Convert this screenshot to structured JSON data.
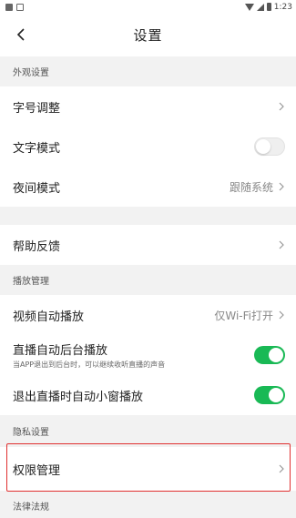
{
  "status_bar": {
    "time": "1:23"
  },
  "header": {
    "title": "设置",
    "back_icon": "chevron-left-icon"
  },
  "sections": {
    "appearance": {
      "title": "外观设置",
      "font_size": {
        "label": "字号调整"
      },
      "text_mode": {
        "label": "文字模式",
        "enabled": false
      },
      "night_mode": {
        "label": "夜间模式",
        "value": "跟随系统"
      }
    },
    "help": {
      "label": "帮助反馈"
    },
    "playback": {
      "title": "播放管理",
      "video_autoplay": {
        "label": "视频自动播放",
        "value": "仅Wi-Fi打开"
      },
      "live_background": {
        "label": "直播自动后台播放",
        "sub": "当APP退出到后台时，可以继续收听直播的声音",
        "enabled": true
      },
      "live_pip": {
        "label": "退出直播时自动小窗播放",
        "enabled": true
      }
    },
    "privacy": {
      "title": "隐私设置",
      "permissions": {
        "label": "权限管理"
      }
    },
    "legal": {
      "title": "法律法规"
    }
  },
  "colors": {
    "toggle_on": "#19b955",
    "highlight": "#e03030",
    "background": "#f2f2f2"
  }
}
